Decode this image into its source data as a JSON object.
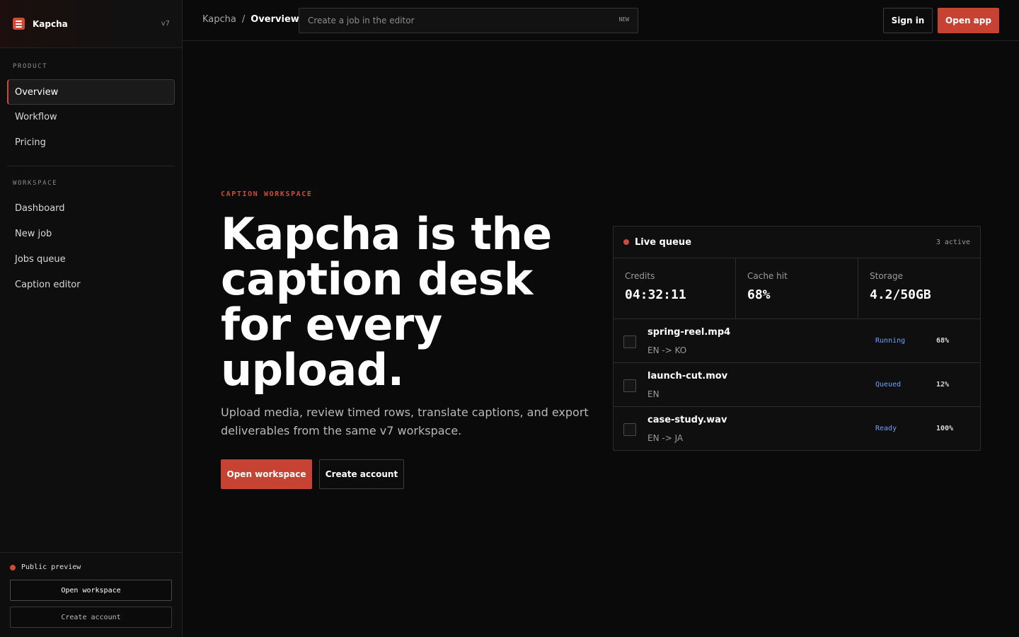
{
  "brand": {
    "name": "Kapcha",
    "version": "v7",
    "accent": "#d04a38"
  },
  "sidebar": {
    "product_label": "PRODUCT",
    "product_items": [
      {
        "label": "Overview",
        "active": true
      },
      {
        "label": "Workflow",
        "active": false
      },
      {
        "label": "Pricing",
        "active": false
      }
    ],
    "workspace_label": "WORKSPACE",
    "workspace_items": [
      {
        "label": "Dashboard"
      },
      {
        "label": "New job"
      },
      {
        "label": "Jobs queue"
      },
      {
        "label": "Caption editor"
      }
    ],
    "footer": {
      "status_text": "Public preview",
      "primary_button": "Open workspace",
      "secondary_button": "Create account"
    }
  },
  "topbar": {
    "breadcrumb_root": "Kapcha",
    "breadcrumb_sep": "/",
    "breadcrumb_current": "Overview",
    "search_placeholder": "Create a job in the editor",
    "search_tag": "NEW",
    "signin_label": "Sign in",
    "openapp_label": "Open app"
  },
  "hero": {
    "eyebrow": "CAPTION WORKSPACE",
    "title": "Kapcha is the caption desk for every upload.",
    "subtitle": "Upload media, review timed rows, translate captions, and export deliverables from the same v7 workspace.",
    "primary_button": "Open workspace",
    "secondary_button": "Create account"
  },
  "queue": {
    "title": "Live queue",
    "count": "3 active",
    "stats": [
      {
        "label": "Credits",
        "value": "04:32:11"
      },
      {
        "label": "Cache hit",
        "value": "68%"
      },
      {
        "label": "Storage",
        "value": "4.2/50GB"
      }
    ],
    "rows": [
      {
        "file": "spring-reel.mp4",
        "lang": "EN -> KO",
        "status": "Running",
        "pct": "68%"
      },
      {
        "file": "launch-cut.mov",
        "lang": "EN",
        "status": "Queued",
        "pct": "12%"
      },
      {
        "file": "case-study.wav",
        "lang": "EN -> JA",
        "status": "Ready",
        "pct": "100%"
      }
    ]
  }
}
